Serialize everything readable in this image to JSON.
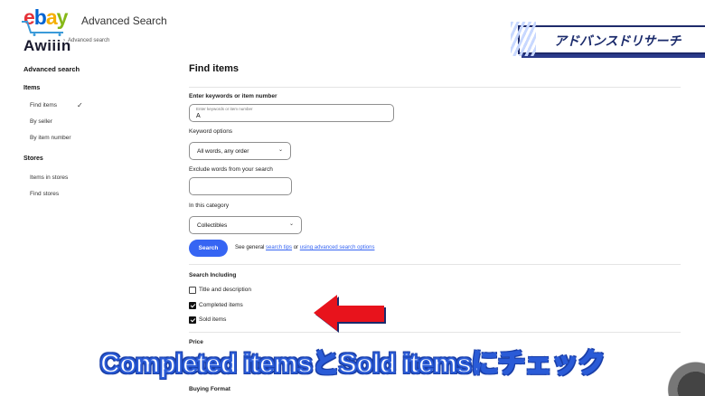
{
  "header": {
    "logo_ebay": [
      "e",
      "b",
      "a",
      "y"
    ],
    "logo_brand": "Awiiin",
    "app_title": "Advanced Search",
    "breadcrumb": "Advanced search"
  },
  "banner": {
    "text": "アドバンスドリサーチ"
  },
  "sidebar": {
    "title": "Advanced search",
    "sections": [
      {
        "label": "Items",
        "items": [
          {
            "label": "Find items",
            "active": true
          },
          {
            "label": "By seller"
          },
          {
            "label": "By item number"
          }
        ]
      },
      {
        "label": "Stores",
        "items": [
          {
            "label": "Items in stores"
          },
          {
            "label": "Find stores"
          }
        ]
      }
    ]
  },
  "main": {
    "title": "Find items",
    "keywords_label": "Enter keywords or item number",
    "keywords_placeholder": "Enter keywords or item number",
    "keywords_value": "A",
    "keyword_options_label": "Keyword options",
    "keyword_options_value": "All words, any order",
    "exclude_label": "Exclude words from your search",
    "exclude_value": "",
    "category_label": "In this category",
    "category_value": "Collectibles",
    "search_button": "Search",
    "tips_prefix": "See general",
    "tips_link1": "search tips",
    "tips_or": "or",
    "tips_link2": "using advanced search options",
    "search_including_label": "Search Including",
    "checkboxes": [
      {
        "label": "Title and description",
        "checked": false
      },
      {
        "label": "Completed items",
        "checked": true
      },
      {
        "label": "Sold items",
        "checked": true
      }
    ],
    "price_label": "Price",
    "buying_format_label": "Buying Format"
  },
  "caption": {
    "text": "Completed itemsとSold itemsにチェック"
  },
  "colors": {
    "accent": "#3665f3",
    "arrow": "#e8131c",
    "caption_outline": "#2a5bd7"
  }
}
